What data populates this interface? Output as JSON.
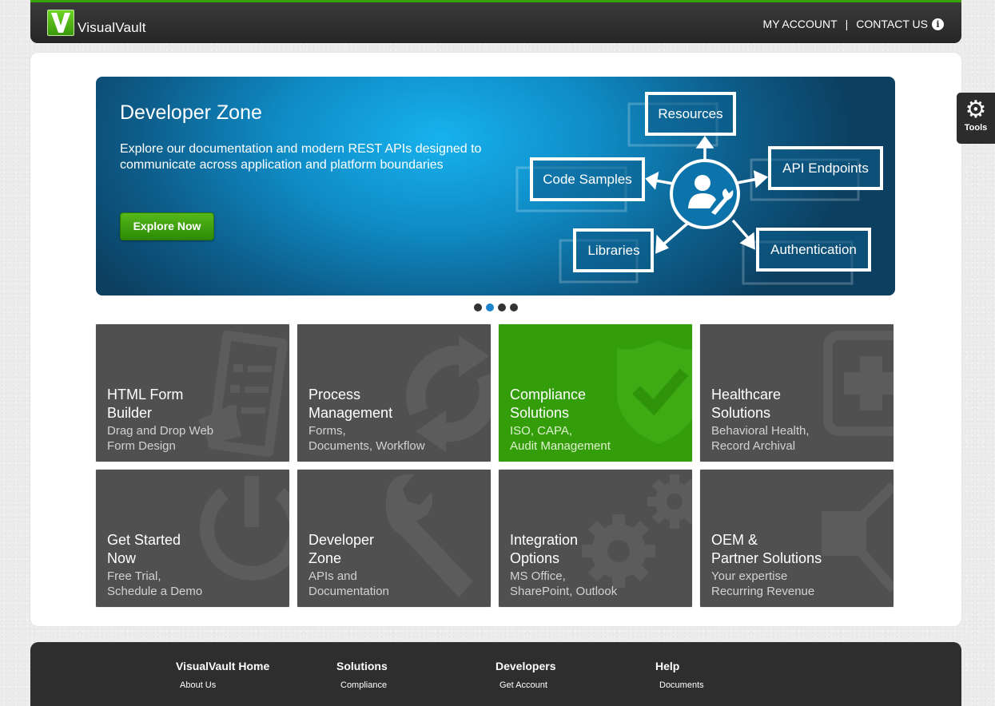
{
  "header": {
    "logo_text": "VisualVault",
    "my_account": "MY ACCOUNT",
    "separator": "|",
    "contact_us": "CONTACT US",
    "info_icon": "i"
  },
  "hero": {
    "title": "Developer Zone",
    "description": "Explore our documentation and modern REST APIs designed to communicate across application and platform boundaries",
    "button_label": "Explore Now",
    "diagram": {
      "resources": "Resources",
      "api_endpoints": "API Endpoints",
      "code_samples": "Code Samples",
      "libraries": "Libraries",
      "authentication": "Authentication",
      "center_icon": "user-wrench-icon"
    }
  },
  "carousel": {
    "slides": 4,
    "active_index": 1
  },
  "tiles": [
    {
      "title": "HTML Form Builder",
      "subtitle": "Drag and Drop Web Form Design",
      "icon": "form-icon"
    },
    {
      "title": "Process Management",
      "subtitle": "Forms, Documents, Workflow",
      "icon": "cycle-arrows-icon"
    },
    {
      "title": "Compliance Solutions",
      "subtitle": "ISO, CAPA, Audit Management",
      "icon": "shield-check-icon"
    },
    {
      "title": "Healthcare Solutions",
      "subtitle": "Behavioral Health, Record Archival",
      "icon": "medical-cross-icon"
    },
    {
      "title": "Get Started Now",
      "subtitle": "Free Trial, Schedule a Demo",
      "icon": "power-icon"
    },
    {
      "title": "Developer Zone",
      "subtitle": "APIs and Documentation",
      "icon": "wrench-icon"
    },
    {
      "title": "Integration Options",
      "subtitle": "MS Office, SharePoint, Outlook",
      "icon": "gears-icon"
    },
    {
      "title": "OEM & Partner Solutions",
      "subtitle": "Your expertise Recurring Revenue",
      "icon": "share-nodes-icon"
    }
  ],
  "tiles_lines": {
    "t0": [
      "HTML Form",
      "Builder",
      "Drag and Drop Web",
      "Form Design"
    ],
    "t1": [
      "Process",
      "Management",
      "Forms,",
      "Documents, Workflow"
    ],
    "t2": [
      "Compliance",
      "Solutions",
      "ISO, CAPA,",
      "Audit Management"
    ],
    "t3": [
      "Healthcare",
      "Solutions",
      "Behavioral Health,",
      "Record Archival"
    ],
    "t4": [
      "Get Started",
      "Now",
      "Free Trial,",
      "Schedule a Demo"
    ],
    "t5": [
      "Developer",
      "Zone",
      "APIs and",
      "Documentation"
    ],
    "t6": [
      "Integration",
      "Options",
      "MS Office,",
      "SharePoint, Outlook"
    ],
    "t7": [
      "OEM &",
      "Partner Solutions",
      "Your expertise",
      "Recurring Revenue"
    ]
  },
  "tools": {
    "label": "Tools",
    "icon": "gear-icon"
  },
  "footer": {
    "columns": [
      {
        "heading": "VisualVault Home",
        "links": [
          "About Us"
        ]
      },
      {
        "heading": "Solutions",
        "links": [
          "Compliance"
        ]
      },
      {
        "heading": "Developers",
        "links": [
          "Get Account"
        ]
      },
      {
        "heading": "Help",
        "links": [
          "Documents"
        ]
      }
    ]
  },
  "colors": {
    "brand_green": "#3aa30a",
    "header_dark": "#2c2c2c",
    "hero_blue": "#0f8cc6",
    "tile_gray": "#505050",
    "tile_green": "#339e0a",
    "carousel_active": "#1c84cc"
  }
}
